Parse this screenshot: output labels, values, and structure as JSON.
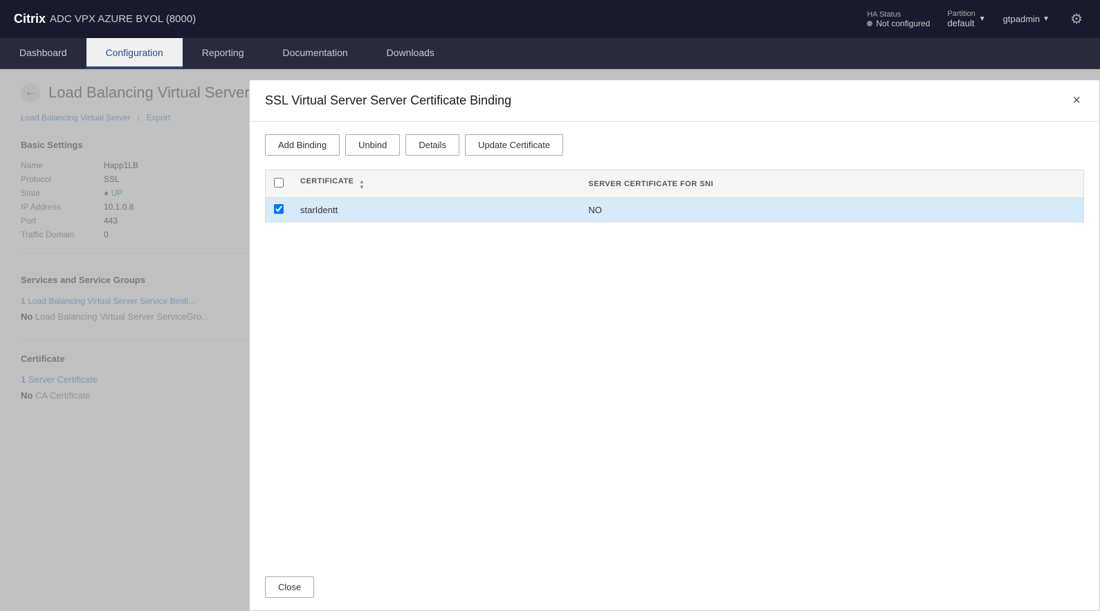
{
  "header": {
    "brand_name": "Citrix",
    "product_name": "ADC VPX AZURE BYOL (8000)",
    "ha_status_label": "HA Status",
    "ha_status_value": "Not configured",
    "partition_label": "Partition",
    "partition_value": "default",
    "user": "gtpadmin"
  },
  "nav": {
    "tabs": [
      {
        "id": "dashboard",
        "label": "Dashboard",
        "active": false
      },
      {
        "id": "configuration",
        "label": "Configuration",
        "active": true
      },
      {
        "id": "reporting",
        "label": "Reporting",
        "active": false
      },
      {
        "id": "documentation",
        "label": "Documentation",
        "active": false
      },
      {
        "id": "downloads",
        "label": "Downloads",
        "active": false
      }
    ]
  },
  "background": {
    "page_title": "Load Balancing Virtual Server",
    "breadcrumb_root": "Load Balancing Virtual Server",
    "breadcrumb_export": "Export",
    "basic_settings_label": "Basic Settings",
    "details": {
      "name_label": "Name",
      "name_value": "Happ1LB",
      "protocol_label": "Protocol",
      "protocol_value": "SSL",
      "state_label": "State",
      "state_value": "UP",
      "ip_label": "IP Address",
      "ip_value": "10.1.0.8",
      "port_label": "Port",
      "port_value": "443",
      "traffic_label": "Traffic Domain",
      "traffic_value": "0"
    },
    "services_title": "Services and Service Groups",
    "service_binding_count": "1",
    "service_binding_label": "Load Balancing Virtual Server Service Bindi...",
    "service_group_prefix": "No",
    "service_group_label": "Load Balancing Virtual Server ServiceGro...",
    "certificate_title": "Certificate",
    "cert_count": "1",
    "cert_label": "Server Certificate",
    "ca_prefix": "No",
    "ca_label": "CA Certificate"
  },
  "modal": {
    "title": "SSL Virtual Server Server Certificate Binding",
    "close_label": "×",
    "buttons": {
      "add_binding": "Add Binding",
      "unbind": "Unbind",
      "details": "Details",
      "update_certificate": "Update Certificate"
    },
    "table": {
      "col_certificate": "CERTIFICATE",
      "col_sni": "SERVER CERTIFICATE FOR SNI",
      "rows": [
        {
          "checked": true,
          "certificate": "starIdentt",
          "sni": "NO"
        }
      ]
    },
    "close_button": "Close"
  }
}
